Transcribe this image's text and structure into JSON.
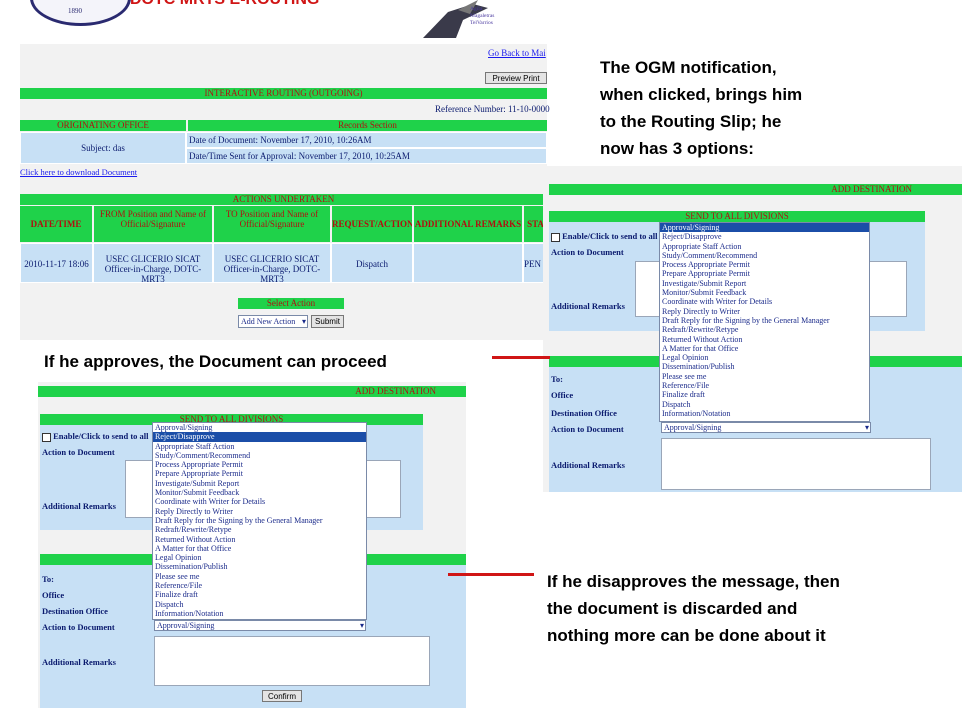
{
  "header": {
    "logo_year": "1890",
    "title_fragment": "DOTC MRTS E-ROUTING",
    "brand_lines": [
      "Agila",
      "Magaletras",
      "TelVarrios"
    ]
  },
  "routing": {
    "go_back": "Go Back to Mai",
    "print_button": "Preview Print",
    "banner": "INTERACTIVE ROUTING (OUTGOING)",
    "reference": "Reference Number: 11-10-0000",
    "originating_office_label": "ORIGINATING OFFICE",
    "records_section": "Records Section",
    "subject": "Subject: das",
    "doc_date": "Date of Document: November 17, 2010, 10:26AM",
    "sent_date": "Date/Time Sent for Approval: November 17, 2010, 10:25AM",
    "download_link": "Click here to download Document",
    "actions_banner": "ACTIONS UNDERTAKEN",
    "columns": [
      "DATE/TIME",
      "FROM Position and Name of Official/Signature",
      "TO Position and Name of Official/Signature",
      "REQUEST/ACTION",
      "ADDITIONAL REMARKS",
      "STA"
    ],
    "row": {
      "date": "2010-11-17 18:06",
      "from": "USEC GLICERIO SICAT Officer-in-Charge, DOTC-MRT3",
      "to": "USEC GLICERIO SICAT Officer-in-Charge, DOTC-MRT3",
      "action": "Dispatch",
      "remarks": "",
      "status": "PEN"
    },
    "select_action_label": "Select Action",
    "select_value": "Add New Action",
    "submit": "Submit"
  },
  "notes": {
    "top": [
      "The OGM notification,",
      "when clicked, brings him",
      "to the Routing Slip; he",
      "now has 3 options:"
    ],
    "approve": "If he approves, the Document can proceed",
    "disapprove": [
      "If he disapproves the message, then",
      "the document is discarded and",
      "nothing more can be done about it"
    ]
  },
  "form": {
    "add_destination": "ADD DESTINATION",
    "send_all": "SEND TO ALL DIVISIONS",
    "enable_label": "Enable/Click to send to all",
    "action_label": "Action to Document",
    "remarks_label": "Additional Remarks",
    "to_label": "To:",
    "office_label": "Office",
    "dest_label": "Destination Office",
    "confirm": "Confirm",
    "selected": "Approval/Signing",
    "options": [
      "Approval/Signing",
      "Reject/Disapprove",
      "Appropriate Staff Action",
      "Study/Comment/Recommend",
      "Process Appropriate Permit",
      "Prepare Appropriate Permit",
      "Investigate/Submit Report",
      "Monitor/Submit Feedback",
      "Coordinate with Writer for Details",
      "Reply Directly to Writer",
      "Draft Reply for the Signing by the General Manager",
      "Redraft/Rewrite/Retype",
      "Returned Without Action",
      "A Matter for that Office",
      "Legal Opinion",
      "Dissemination/Publish",
      "Please see me",
      "Reference/File",
      "Finalize draft",
      "Dispatch",
      "Information/Notation"
    ]
  },
  "colors": {
    "green": "#1fd24a",
    "cell": "#c7e0f5",
    "red": "#d01515"
  }
}
